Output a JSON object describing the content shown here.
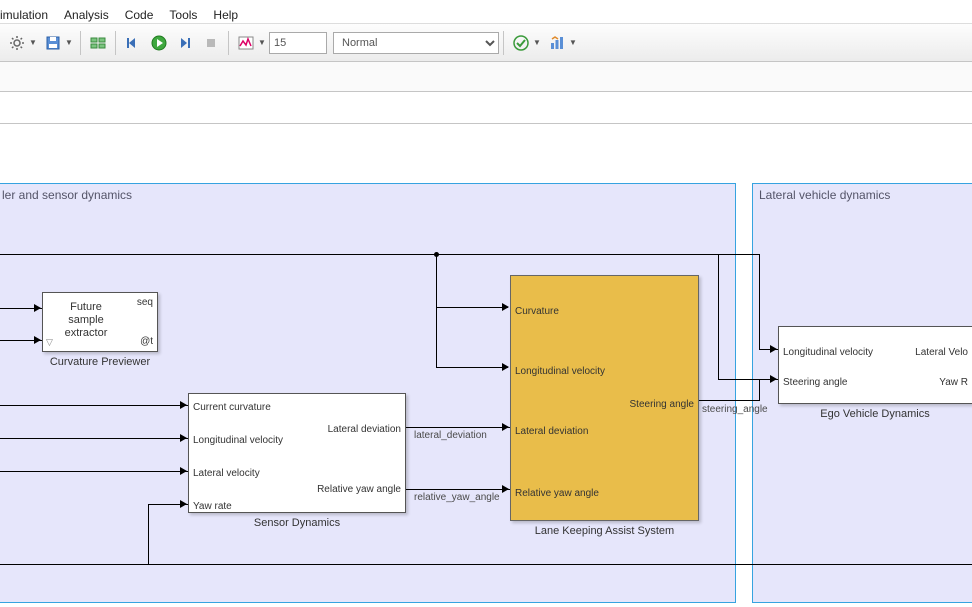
{
  "menu": {
    "items": [
      "imulation",
      "Analysis",
      "Code",
      "Tools",
      "Help"
    ]
  },
  "toolbar": {
    "stop_time": "15",
    "mode": "Normal"
  },
  "subsystems": {
    "controller": {
      "title": "ler and sensor dynamics"
    },
    "lateral": {
      "title": "Lateral vehicle dynamics"
    }
  },
  "blocks": {
    "previewer": {
      "label": "Curvature Previewer",
      "center_l1": "Future",
      "center_l2": "sample",
      "center_l3": "extractor",
      "seq": "seq",
      "at": "@t"
    },
    "sensor": {
      "label": "Sensor Dynamics",
      "in1": "Current curvature",
      "in2": "Longitudinal velocity",
      "in3": "Lateral velocity",
      "in4": "Yaw rate",
      "out1": "Lateral deviation",
      "out2": "Relative yaw angle"
    },
    "lkas": {
      "label": "Lane Keeping Assist System",
      "in1": "Curvature",
      "in2": "Longitudinal velocity",
      "in3": "Lateral deviation",
      "in4": "Relative yaw angle",
      "out1": "Steering angle"
    },
    "ego": {
      "label": "Ego Vehicle Dynamics",
      "in1": "Longitudinal velocity",
      "in2": "Steering angle",
      "out1": "Lateral Velo",
      "out2": "Yaw R"
    }
  },
  "signals": {
    "lat_dev": "lateral_deviation",
    "rel_yaw": "relative_yaw_angle",
    "steer": "steering_angle"
  }
}
